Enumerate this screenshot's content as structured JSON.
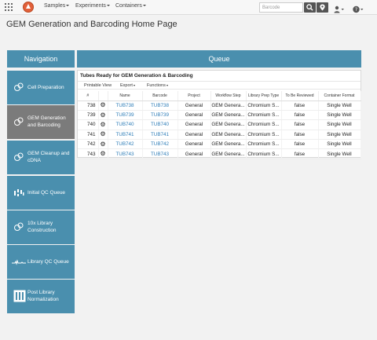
{
  "navbar": {
    "menus": [
      {
        "label": "Samples"
      },
      {
        "label": "Experiments"
      },
      {
        "label": "Containers"
      }
    ],
    "search_placeholder": "Barcode"
  },
  "page": {
    "title": "GEM Generation and Barcoding Home Page"
  },
  "navigation": {
    "header": "Navigation",
    "items": [
      {
        "label": "Cell Preparation",
        "icon": "flask-icon",
        "active": false
      },
      {
        "label": "GEM Generation and Barcoding",
        "icon": "flask-icon",
        "active": true
      },
      {
        "label": "GEM Cleanup and cDNA",
        "icon": "flask-icon",
        "active": false
      },
      {
        "label": "Initial QC Queue",
        "icon": "gel-icon",
        "active": false
      },
      {
        "label": "10x Library Construction",
        "icon": "flask-icon",
        "active": false
      },
      {
        "label": "Library QC Queue",
        "icon": "trace-icon",
        "active": false
      },
      {
        "label": "Post Library Normalization",
        "icon": "plate-icon",
        "active": false
      }
    ]
  },
  "queue": {
    "header": "Queue",
    "title": "Tubes Ready for GEM Generation & Barcoding",
    "toolbar": {
      "printable": "Printable View",
      "export": "Export",
      "functions": "Functions"
    },
    "columns": [
      "#",
      "",
      "Name",
      "Barcode",
      "Project",
      "Workflow Step",
      "Library Prep Type",
      "To Be Reviewed",
      "Container Format"
    ],
    "rows": [
      {
        "num": "738",
        "name": "TUB738",
        "barcode": "TUB738",
        "project": "General",
        "step": "GEM Genera...",
        "prep": "Chromium S...",
        "review": "false",
        "format": "Single Well"
      },
      {
        "num": "739",
        "name": "TUB739",
        "barcode": "TUB739",
        "project": "General",
        "step": "GEM Genera...",
        "prep": "Chromium S...",
        "review": "false",
        "format": "Single Well"
      },
      {
        "num": "740",
        "name": "TUB740",
        "barcode": "TUB740",
        "project": "General",
        "step": "GEM Genera...",
        "prep": "Chromium S...",
        "review": "false",
        "format": "Single Well"
      },
      {
        "num": "741",
        "name": "TUB741",
        "barcode": "TUB741",
        "project": "General",
        "step": "GEM Genera...",
        "prep": "Chromium S...",
        "review": "false",
        "format": "Single Well"
      },
      {
        "num": "742",
        "name": "TUB742",
        "barcode": "TUB742",
        "project": "General",
        "step": "GEM Genera...",
        "prep": "Chromium S...",
        "review": "false",
        "format": "Single Well"
      },
      {
        "num": "743",
        "name": "TUB743",
        "barcode": "TUB743",
        "project": "General",
        "step": "GEM Genera...",
        "prep": "Chromium S...",
        "review": "false",
        "format": "Single Well"
      }
    ]
  },
  "colors": {
    "accent": "#4a8fae",
    "active_tile": "#7b7b7b",
    "link": "#2e7db8"
  }
}
